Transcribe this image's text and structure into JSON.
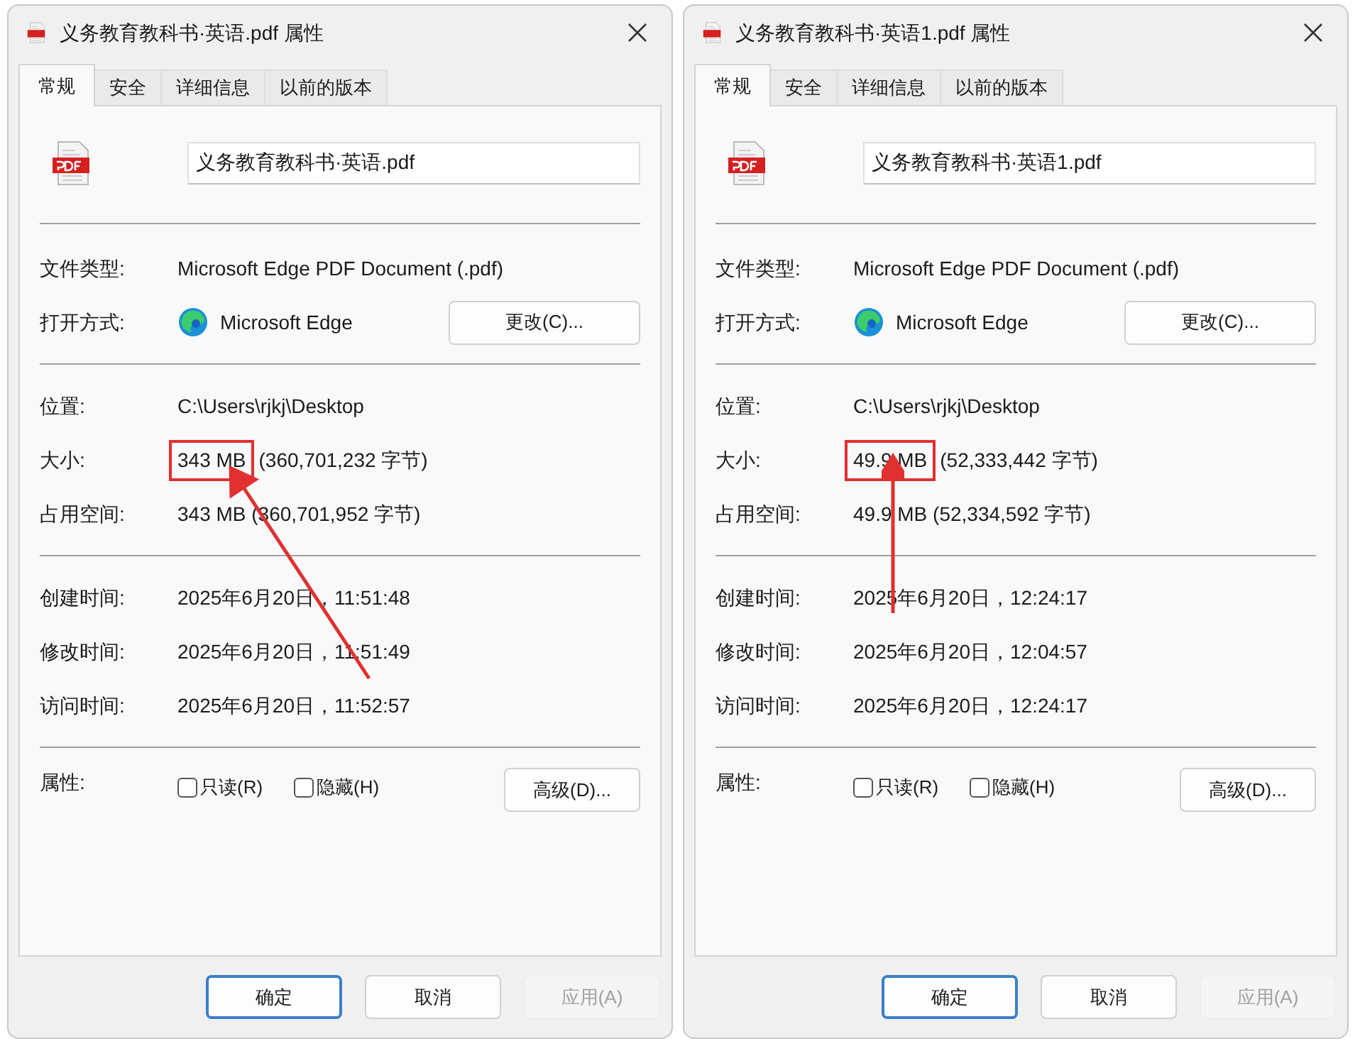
{
  "dialogs": [
    {
      "title": "义务教育教科书·英语.pdf 属性",
      "tabs": [
        {
          "label": "常规",
          "selected": true
        },
        {
          "label": "安全",
          "selected": false
        },
        {
          "label": "详细信息",
          "selected": false
        },
        {
          "label": "以前的版本",
          "selected": false
        }
      ],
      "file_name": "义务教育教科书·英语.pdf",
      "file_type": {
        "label": "文件类型:",
        "value": "Microsoft Edge PDF Document (.pdf)"
      },
      "open_with": {
        "label": "打开方式:",
        "app": "Microsoft Edge",
        "button": "更改(C)..."
      },
      "location": {
        "label": "位置:",
        "value": "C:\\Users\\rjkj\\Desktop"
      },
      "size": {
        "label": "大小:",
        "value": "343 MB",
        "bytes": "(360,701,232 字节)",
        "highlighted": true
      },
      "size_on_disk": {
        "label": "占用空间:",
        "value": "343 MB (360,701,952 字节)"
      },
      "times": [
        {
          "label": "创建时间:",
          "value": "2025年6月20日，11:51:48"
        },
        {
          "label": "修改时间:",
          "value": "2025年6月20日，11:51:49"
        },
        {
          "label": "访问时间:",
          "value": "2025年6月20日，11:52:57"
        }
      ],
      "attributes": {
        "label": "属性:",
        "checkboxes": [
          {
            "label": "只读(R)",
            "checked": false
          },
          {
            "label": "隐藏(H)",
            "checked": false
          }
        ],
        "button": "高级(D)..."
      },
      "arrow": true,
      "buttons": [
        {
          "label": "确定",
          "kind": "default"
        },
        {
          "label": "取消",
          "kind": "normal"
        },
        {
          "label": "应用(A)",
          "kind": "disabled"
        }
      ]
    },
    {
      "title": "义务教育教科书·英语1.pdf 属性",
      "tabs": [
        {
          "label": "常规",
          "selected": true
        },
        {
          "label": "安全",
          "selected": false
        },
        {
          "label": "详细信息",
          "selected": false
        },
        {
          "label": "以前的版本",
          "selected": false
        }
      ],
      "file_name": "义务教育教科书·英语1.pdf",
      "file_type": {
        "label": "文件类型:",
        "value": "Microsoft Edge PDF Document (.pdf)"
      },
      "open_with": {
        "label": "打开方式:",
        "app": "Microsoft Edge",
        "button": "更改(C)..."
      },
      "location": {
        "label": "位置:",
        "value": "C:\\Users\\rjkj\\Desktop"
      },
      "size": {
        "label": "大小:",
        "value": "49.9 MB",
        "bytes": "(52,333,442 字节)",
        "highlighted": true
      },
      "size_on_disk": {
        "label": "占用空间:",
        "value": "49.9 MB (52,334,592 字节)"
      },
      "times": [
        {
          "label": "创建时间:",
          "value": "2025年6月20日，12:24:17"
        },
        {
          "label": "修改时间:",
          "value": "2025年6月20日，12:04:57"
        },
        {
          "label": "访问时间:",
          "value": "2025年6月20日，12:24:17"
        }
      ],
      "attributes": {
        "label": "属性:",
        "checkboxes": [
          {
            "label": "只读(R)",
            "checked": false
          },
          {
            "label": "隐藏(H)",
            "checked": false
          }
        ],
        "button": "高级(D)..."
      },
      "arrow": true,
      "buttons": [
        {
          "label": "确定",
          "kind": "default"
        },
        {
          "label": "取消",
          "kind": "normal"
        },
        {
          "label": "应用(A)",
          "kind": "disabled"
        }
      ]
    }
  ]
}
